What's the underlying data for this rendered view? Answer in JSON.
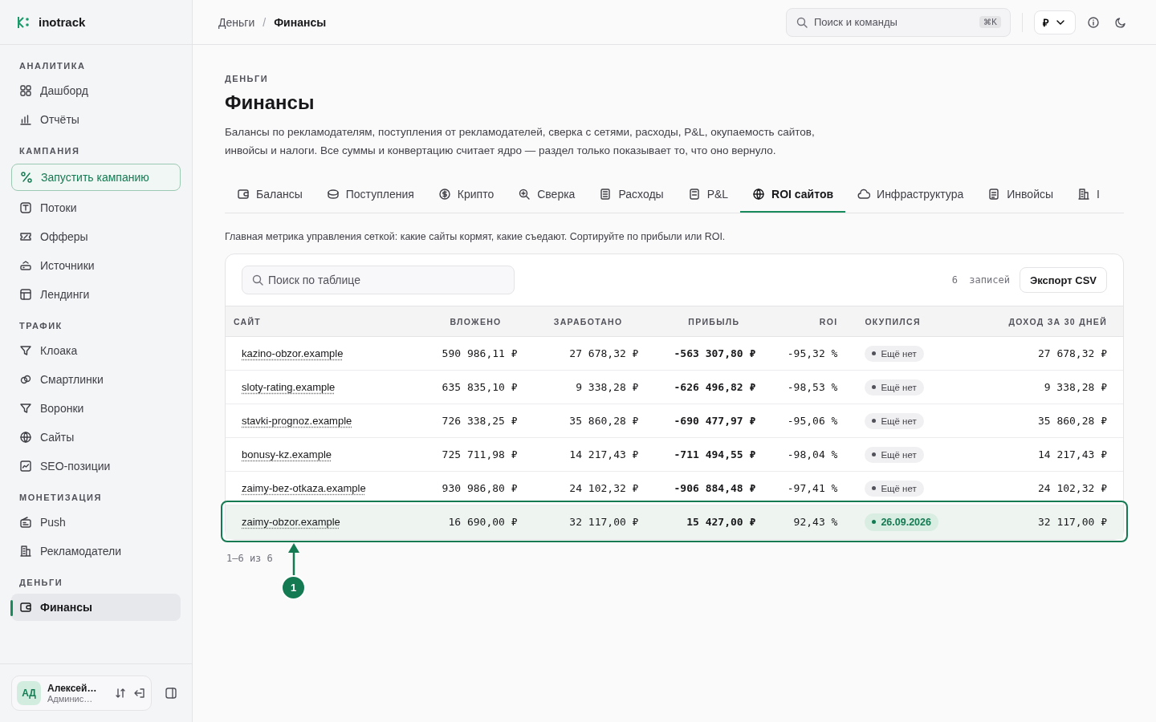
{
  "brand": {
    "name": "inotrack"
  },
  "sidebar": {
    "sections": [
      {
        "title": "АНАЛИТИКА",
        "items": [
          {
            "label": "Дашборд",
            "selected": false,
            "kind": "link"
          },
          {
            "label": "Отчёты",
            "selected": false,
            "kind": "link"
          }
        ]
      },
      {
        "title": "КАМПАНИЯ",
        "items": [
          {
            "label": "Запустить кампанию",
            "selected": false,
            "kind": "cta"
          },
          {
            "label": "Потоки",
            "selected": false,
            "kind": "link"
          },
          {
            "label": "Офферы",
            "selected": false,
            "kind": "link"
          },
          {
            "label": "Источники",
            "selected": false,
            "kind": "link"
          },
          {
            "label": "Лендинги",
            "selected": false,
            "kind": "link"
          }
        ]
      },
      {
        "title": "ТРАФИК",
        "items": [
          {
            "label": "Клоака",
            "selected": false,
            "kind": "link"
          },
          {
            "label": "Смартлинки",
            "selected": false,
            "kind": "link"
          },
          {
            "label": "Воронки",
            "selected": false,
            "kind": "link"
          },
          {
            "label": "Сайты",
            "selected": false,
            "kind": "link"
          },
          {
            "label": "SEO-позиции",
            "selected": false,
            "kind": "link"
          }
        ]
      },
      {
        "title": "МОНЕТИЗАЦИЯ",
        "items": [
          {
            "label": "Push",
            "selected": false,
            "kind": "link"
          },
          {
            "label": "Рекламодатели",
            "selected": false,
            "kind": "link"
          }
        ]
      },
      {
        "title": "ДЕНЬГИ",
        "items": [
          {
            "label": "Финансы",
            "selected": true,
            "kind": "link"
          }
        ]
      }
    ]
  },
  "user": {
    "initials": "АД",
    "name": "Алексей…",
    "role": "Админис…"
  },
  "breadcrumbs": [
    {
      "label": "Деньги",
      "current": false
    },
    {
      "label": "Финансы",
      "current": true
    }
  ],
  "breadcrumb_separator": "/",
  "header": {
    "search_placeholder": "Поиск и команды",
    "shortcut": "⌘K",
    "currency": "₽"
  },
  "page": {
    "eyebrow": "ДЕНЬГИ",
    "title": "Финансы",
    "description": "Балансы по рекламодателям, поступления от рекламодателей, сверка с сетями, расходы, P&L, окупаемость сайтов, инвойсы и налоги. Все суммы и конвертацию считает ядро — раздел только показывает то, что оно вернуло."
  },
  "tabs": [
    {
      "label": "Балансы",
      "selected": false
    },
    {
      "label": "Поступления",
      "selected": false
    },
    {
      "label": "Крипто",
      "selected": false
    },
    {
      "label": "Сверка",
      "selected": false
    },
    {
      "label": "Расходы",
      "selected": false
    },
    {
      "label": "P&L",
      "selected": false
    },
    {
      "label": "ROI сайтов",
      "selected": true
    },
    {
      "label": "Инфраструктура",
      "selected": false
    },
    {
      "label": "Инвойсы",
      "selected": false
    },
    {
      "label": "I",
      "selected": false
    }
  ],
  "tab_description": "Главная метрика управления сеткой: какие сайты кормят, какие съедают. Сортируйте по прибыли или ROI.",
  "table": {
    "search_placeholder": "Поиск по таблице",
    "count": "6",
    "count_label": "записей",
    "export_button": "Экспорт CSV",
    "columns": [
      "САЙТ",
      "ВЛОЖЕНО",
      "ЗАРАБОТАНО",
      "ПРИБЫЛЬ",
      "ROI",
      "ОКУПИЛСЯ",
      "ДОХОД ЗА 30 ДНЕЙ"
    ],
    "rows": [
      {
        "site": "kazino-obzor.example",
        "invested": "590 986,11 ₽",
        "earned": "27 678,32 ₽",
        "profit": "-563 307,80 ₽",
        "roi": "-95,32 %",
        "payback": "Ещё нет",
        "paid_back": false,
        "income_30d": "27 678,32 ₽",
        "highlighted": false
      },
      {
        "site": "sloty-rating.example",
        "invested": "635 835,10 ₽",
        "earned": "9 338,28 ₽",
        "profit": "-626 496,82 ₽",
        "roi": "-98,53 %",
        "payback": "Ещё нет",
        "paid_back": false,
        "income_30d": "9 338,28 ₽",
        "highlighted": false
      },
      {
        "site": "stavki-prognoz.example",
        "invested": "726 338,25 ₽",
        "earned": "35 860,28 ₽",
        "profit": "-690 477,97 ₽",
        "roi": "-95,06 %",
        "payback": "Ещё нет",
        "paid_back": false,
        "income_30d": "35 860,28 ₽",
        "highlighted": false
      },
      {
        "site": "bonusy-kz.example",
        "invested": "725 711,98 ₽",
        "earned": "14 217,43 ₽",
        "profit": "-711 494,55 ₽",
        "roi": "-98,04 %",
        "payback": "Ещё нет",
        "paid_back": false,
        "income_30d": "14 217,43 ₽",
        "highlighted": false
      },
      {
        "site": "zaimy-bez-otkaza.example",
        "invested": "930 986,80 ₽",
        "earned": "24 102,32 ₽",
        "profit": "-906 884,48 ₽",
        "roi": "-97,41 %",
        "payback": "Ещё нет",
        "paid_back": false,
        "income_30d": "24 102,32 ₽",
        "highlighted": false
      },
      {
        "site": "zaimy-obzor.example",
        "invested": "16 690,00 ₽",
        "earned": "32 117,00 ₽",
        "profit": "15 427,00 ₽",
        "roi": "92,43 %",
        "payback": "26.09.2026",
        "paid_back": true,
        "income_30d": "32 117,00 ₽",
        "highlighted": true
      }
    ],
    "pagination": "1–6 из 6"
  },
  "annotation": {
    "number": "1"
  }
}
